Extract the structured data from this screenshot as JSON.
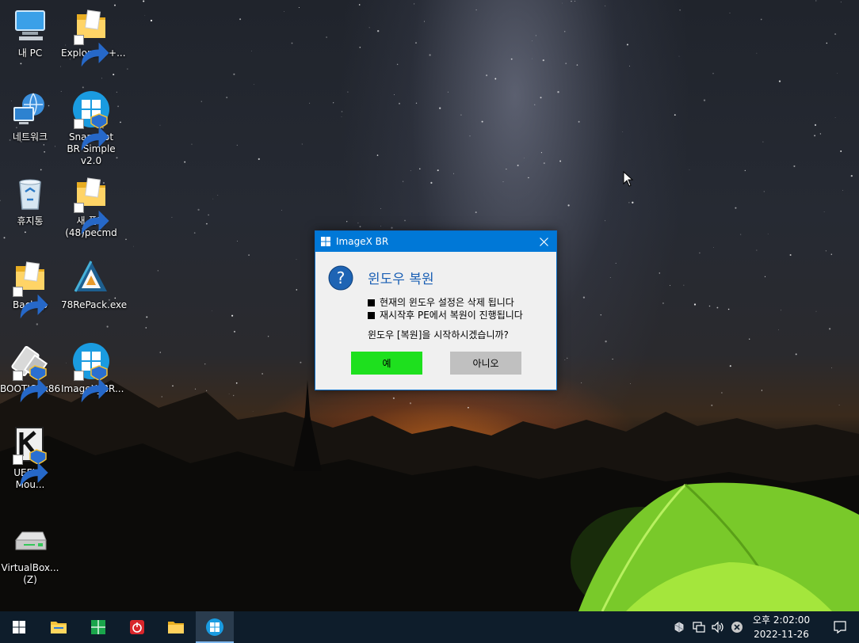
{
  "desktop": {
    "icons": [
      {
        "label": "내 PC",
        "icon": "computer-icon",
        "shortcut": false
      },
      {
        "label": "Explorer++...",
        "icon": "folder-icon",
        "shortcut": true
      },
      {
        "label": "네트워크",
        "icon": "network-icon",
        "shortcut": false
      },
      {
        "label": "Snapshot BR Simple v2.0",
        "icon": "windows-logo-icon",
        "shortcut": true
      },
      {
        "label": "휴지통",
        "icon": "recycle-bin-icon",
        "shortcut": false
      },
      {
        "label": "새 폴더 (48)pecmd",
        "icon": "folder-icon",
        "shortcut": true
      },
      {
        "label": "Backup",
        "icon": "folder-icon",
        "shortcut": true
      },
      {
        "label": "78RePack.exe",
        "icon": "triangle-app-icon",
        "shortcut": false
      },
      {
        "label": "BOOTICEx86",
        "icon": "bootice-icon",
        "shortcut": true
      },
      {
        "label": "ImageX_BR...",
        "icon": "windows-logo-icon",
        "shortcut": true
      },
      {
        "label": "UEFI K-Mou...",
        "icon": "k-app-icon",
        "shortcut": true
      },
      {
        "label": "VirtualBox... (Z)",
        "icon": "drive-icon",
        "shortcut": false
      }
    ]
  },
  "dialog": {
    "title": "ImageX BR",
    "heading": "윈도우 복원",
    "lines": [
      "현재의 윈도우 설정은 삭제 됩니다",
      "재시작후 PE에서 복원이 진행됩니다"
    ],
    "question": "윈도우 [복원]을  시작하시겠습니까?",
    "yes_label": "예",
    "no_label": "아니오",
    "accent": "#0078d7",
    "yes_color": "#1ee01e",
    "no_color": "#c0c0c0"
  },
  "taskbar": {
    "items": [
      "start-icon",
      "file-explorer-icon",
      "spreadsheet-app-icon",
      "power-app-icon",
      "folder-icon",
      "imagex-br-icon"
    ],
    "active_item": "imagex-br-icon",
    "tray": [
      "usb-device-icon",
      "network-icon",
      "volume-icon",
      "close-circle-icon"
    ],
    "clock_time": "오후 2:02:00",
    "clock_date": "2022-11-26"
  }
}
